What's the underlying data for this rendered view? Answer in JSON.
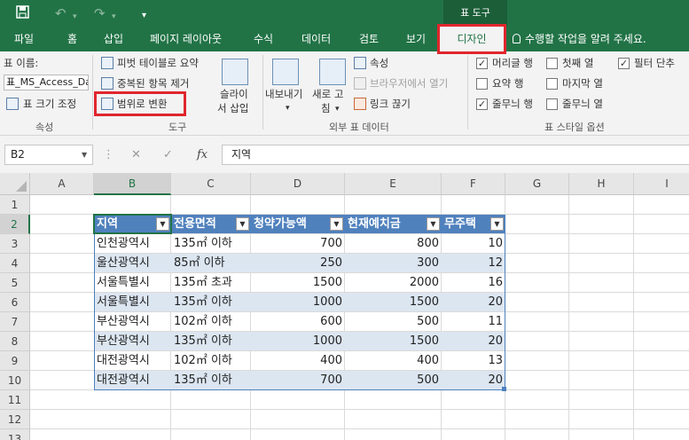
{
  "titlebar": {
    "save_icon": "save-icon",
    "undo_icon": "undo-icon",
    "redo_icon": "redo-icon",
    "context_title": "표 도구"
  },
  "tabs": {
    "file": "파일",
    "home": "홈",
    "insert": "삽입",
    "page_layout": "페이지 레이아웃",
    "formulas": "수식",
    "data": "데이터",
    "review": "검토",
    "view": "보기",
    "design": "디자인",
    "tell_me": "수행할 작업을 알려 주세요."
  },
  "ribbon": {
    "properties": {
      "table_name_label": "표 이름:",
      "table_name_value": "표_MS_Access_Da",
      "resize_table": "표 크기 조정",
      "group_name": "속성"
    },
    "tools": {
      "pivot_summary": "피벗 테이블로 요약",
      "remove_duplicates": "중복된 항목 제거",
      "convert_to_range": "범위로 변환",
      "slicer_line1": "슬라이",
      "slicer_line2": "서 삽입",
      "group_name": "도구"
    },
    "external": {
      "export": "내보내기",
      "refresh_line1": "새로 고",
      "refresh_line2": "침",
      "properties": "속성",
      "open_in_browser": "브라우저에서 열기",
      "unlink": "링크 끊기",
      "group_name": "외부 표 데이터"
    },
    "style_options": {
      "header_row": "머리글 행",
      "total_row": "요약 행",
      "banded_rows": "줄무늬 행",
      "first_column": "첫째 열",
      "last_column": "마지막 열",
      "banded_columns": "줄무늬 열",
      "filter_button": "필터 단추",
      "header_row_checked": true,
      "total_row_checked": false,
      "banded_rows_checked": true,
      "first_column_checked": false,
      "last_column_checked": false,
      "banded_columns_checked": false,
      "filter_button_checked": true,
      "group_name": "표 스타일 옵션"
    }
  },
  "formula_bar": {
    "name_box": "B2",
    "cancel": "✕",
    "enter": "✓",
    "fx": "fx",
    "content": "지역"
  },
  "sheet": {
    "columns": [
      "A",
      "B",
      "C",
      "D",
      "E",
      "F",
      "G",
      "H",
      "I"
    ],
    "rows": [
      "1",
      "2",
      "3",
      "4",
      "5",
      "6",
      "7",
      "8",
      "9",
      "10",
      "11",
      "12",
      "13"
    ],
    "table_headers": [
      "지역",
      "전용면적",
      "청약가능액",
      "현재예치금",
      "무주택"
    ],
    "table_rows": [
      [
        "인천광역시",
        "135㎡ 이하",
        "700",
        "800",
        "10"
      ],
      [
        "울산광역시",
        "85㎡ 이하",
        "250",
        "300",
        "12"
      ],
      [
        "서울특별시",
        "135㎡ 초과",
        "1500",
        "2000",
        "16"
      ],
      [
        "서울특별시",
        "135㎡ 이하",
        "1000",
        "1500",
        "20"
      ],
      [
        "부산광역시",
        "102㎡ 이하",
        "600",
        "500",
        "11"
      ],
      [
        "부산광역시",
        "135㎡ 이하",
        "1000",
        "1500",
        "20"
      ],
      [
        "대전광역시",
        "102㎡ 이하",
        "400",
        "400",
        "13"
      ],
      [
        "대전광역시",
        "135㎡ 이하",
        "700",
        "500",
        "20"
      ]
    ]
  },
  "colors": {
    "excel_green": "#217346",
    "table_header": "#4f81bd",
    "table_band": "#dce6f1",
    "highlight_red": "#e0262d"
  }
}
